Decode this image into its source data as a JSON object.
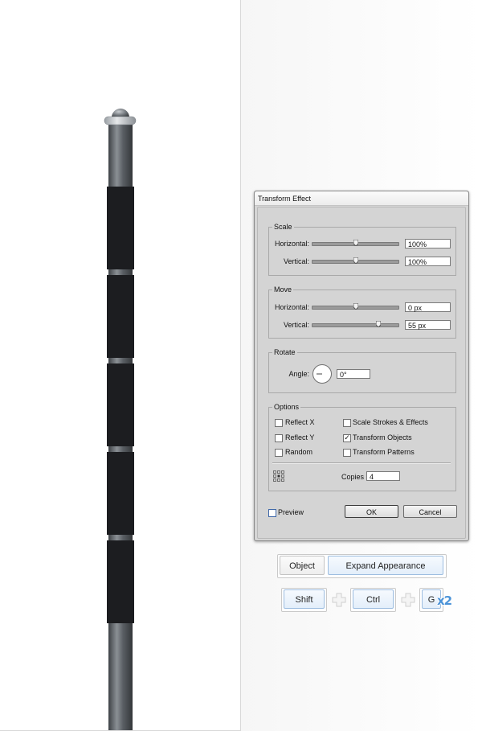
{
  "dialog": {
    "title": "Transform Effect",
    "scale": {
      "legend": "Scale",
      "horizontal_label": "Horizontal:",
      "horizontal_value": "100%",
      "horizontal_slider": 0.5,
      "vertical_label": "Vertical:",
      "vertical_value": "100%",
      "vertical_slider": 0.5
    },
    "move": {
      "legend": "Move",
      "horizontal_label": "Horizontal:",
      "horizontal_value": "0 px",
      "horizontal_slider": 0.5,
      "vertical_label": "Vertical:",
      "vertical_value": "55 px",
      "vertical_slider": 0.77
    },
    "rotate": {
      "legend": "Rotate",
      "angle_label": "Angle:",
      "angle_value": "0°"
    },
    "options": {
      "legend": "Options",
      "reflect_x": {
        "label": "Reflect X",
        "checked": false
      },
      "reflect_y": {
        "label": "Reflect Y",
        "checked": false
      },
      "random": {
        "label": "Random",
        "checked": false
      },
      "scale_strokes": {
        "label": "Scale Strokes & Effects",
        "checked": false
      },
      "transform_objects": {
        "label": "Transform Objects",
        "checked": true
      },
      "transform_patterns": {
        "label": "Transform Patterns",
        "checked": false
      },
      "copies_label": "Copies",
      "copies_value": "4"
    },
    "preview": {
      "label": "Preview",
      "checked": false
    },
    "ok_label": "OK",
    "cancel_label": "Cancel"
  },
  "menu_path": {
    "object_label": "Object",
    "expand_label": "Expand Appearance"
  },
  "shortcut": {
    "key1": "Shift",
    "key2": "Ctrl",
    "key3": "G",
    "repeat": "x2"
  },
  "colors": {
    "pole_band": "#1c1d20",
    "pole_metal": "#5a5e62",
    "key_border": "#9dbde0",
    "repeat_badge": "#4b93d8"
  }
}
